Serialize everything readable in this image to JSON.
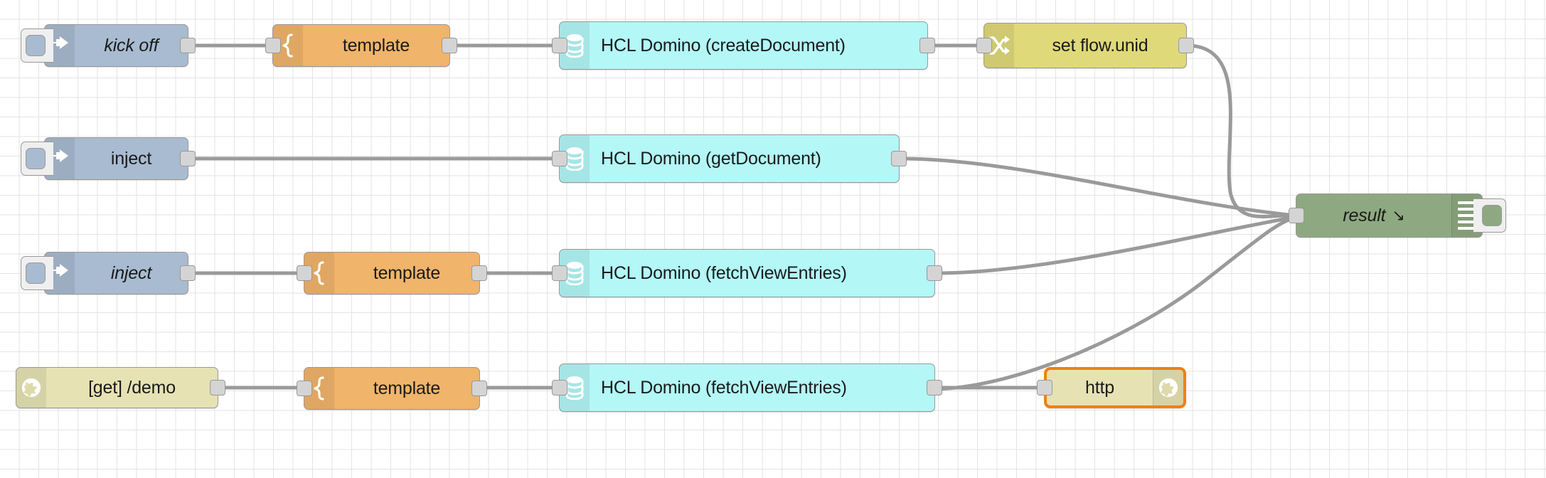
{
  "app": {
    "name": "Node-RED Flow Editor",
    "canvas_background": "#ffffff",
    "grid_color": "#e3e3e3"
  },
  "palette": {
    "inject": "#a8bbd0",
    "template": "#f0b46b",
    "domino": "#b3f7f7",
    "change": "#dfd97a",
    "http": "#e6e2b4",
    "debug": "#8ea981",
    "wire": "#9a9a9a",
    "selection": "#ef8013"
  },
  "rows": [
    {
      "id": "row-1",
      "nodes": [
        {
          "key": "kick-off",
          "type": "inject",
          "label": "kick off",
          "italic": true,
          "icon": "inject-arrow-icon"
        },
        {
          "key": "template-1",
          "type": "template",
          "label": "template",
          "italic": false,
          "icon": "brace-icon"
        },
        {
          "key": "domino-create",
          "type": "domino",
          "label": "HCL Domino (createDocument)",
          "italic": false,
          "icon": "database-icon"
        },
        {
          "key": "set-flow-unid",
          "type": "change",
          "label": "set flow.unid",
          "italic": false,
          "icon": "shuffle-icon"
        }
      ]
    },
    {
      "id": "row-2",
      "nodes": [
        {
          "key": "inject-2",
          "type": "inject",
          "label": "inject",
          "italic": false,
          "icon": "inject-arrow-icon"
        },
        {
          "key": "domino-get",
          "type": "domino",
          "label": "HCL Domino (getDocument)",
          "italic": false,
          "icon": "database-icon"
        }
      ]
    },
    {
      "id": "row-3",
      "nodes": [
        {
          "key": "inject-3",
          "type": "inject",
          "label": "inject",
          "italic": true,
          "icon": "inject-arrow-icon"
        },
        {
          "key": "template-3",
          "type": "template",
          "label": "template",
          "italic": false,
          "icon": "brace-icon"
        },
        {
          "key": "domino-fetch-3",
          "type": "domino",
          "label": "HCL Domino (fetchViewEntries)",
          "italic": false,
          "icon": "database-icon"
        }
      ]
    },
    {
      "id": "row-4",
      "nodes": [
        {
          "key": "http-in-demo",
          "type": "http",
          "label": "[get] /demo",
          "italic": false,
          "icon": "globe-icon"
        },
        {
          "key": "template-4",
          "type": "template",
          "label": "template",
          "italic": false,
          "icon": "brace-icon"
        },
        {
          "key": "domino-fetch-4",
          "type": "domino",
          "label": "HCL Domino (fetchViewEntries)",
          "italic": false,
          "icon": "database-icon"
        },
        {
          "key": "http-response",
          "type": "http",
          "label": "http",
          "italic": false,
          "icon": "globe-icon",
          "selected": true
        }
      ]
    }
  ],
  "debug_node": {
    "key": "result",
    "type": "debug",
    "label": "result",
    "suffix_glyph": "↘",
    "italic": true,
    "icon": "debug-lines-icon",
    "toggle": "debug-toggle-button"
  }
}
